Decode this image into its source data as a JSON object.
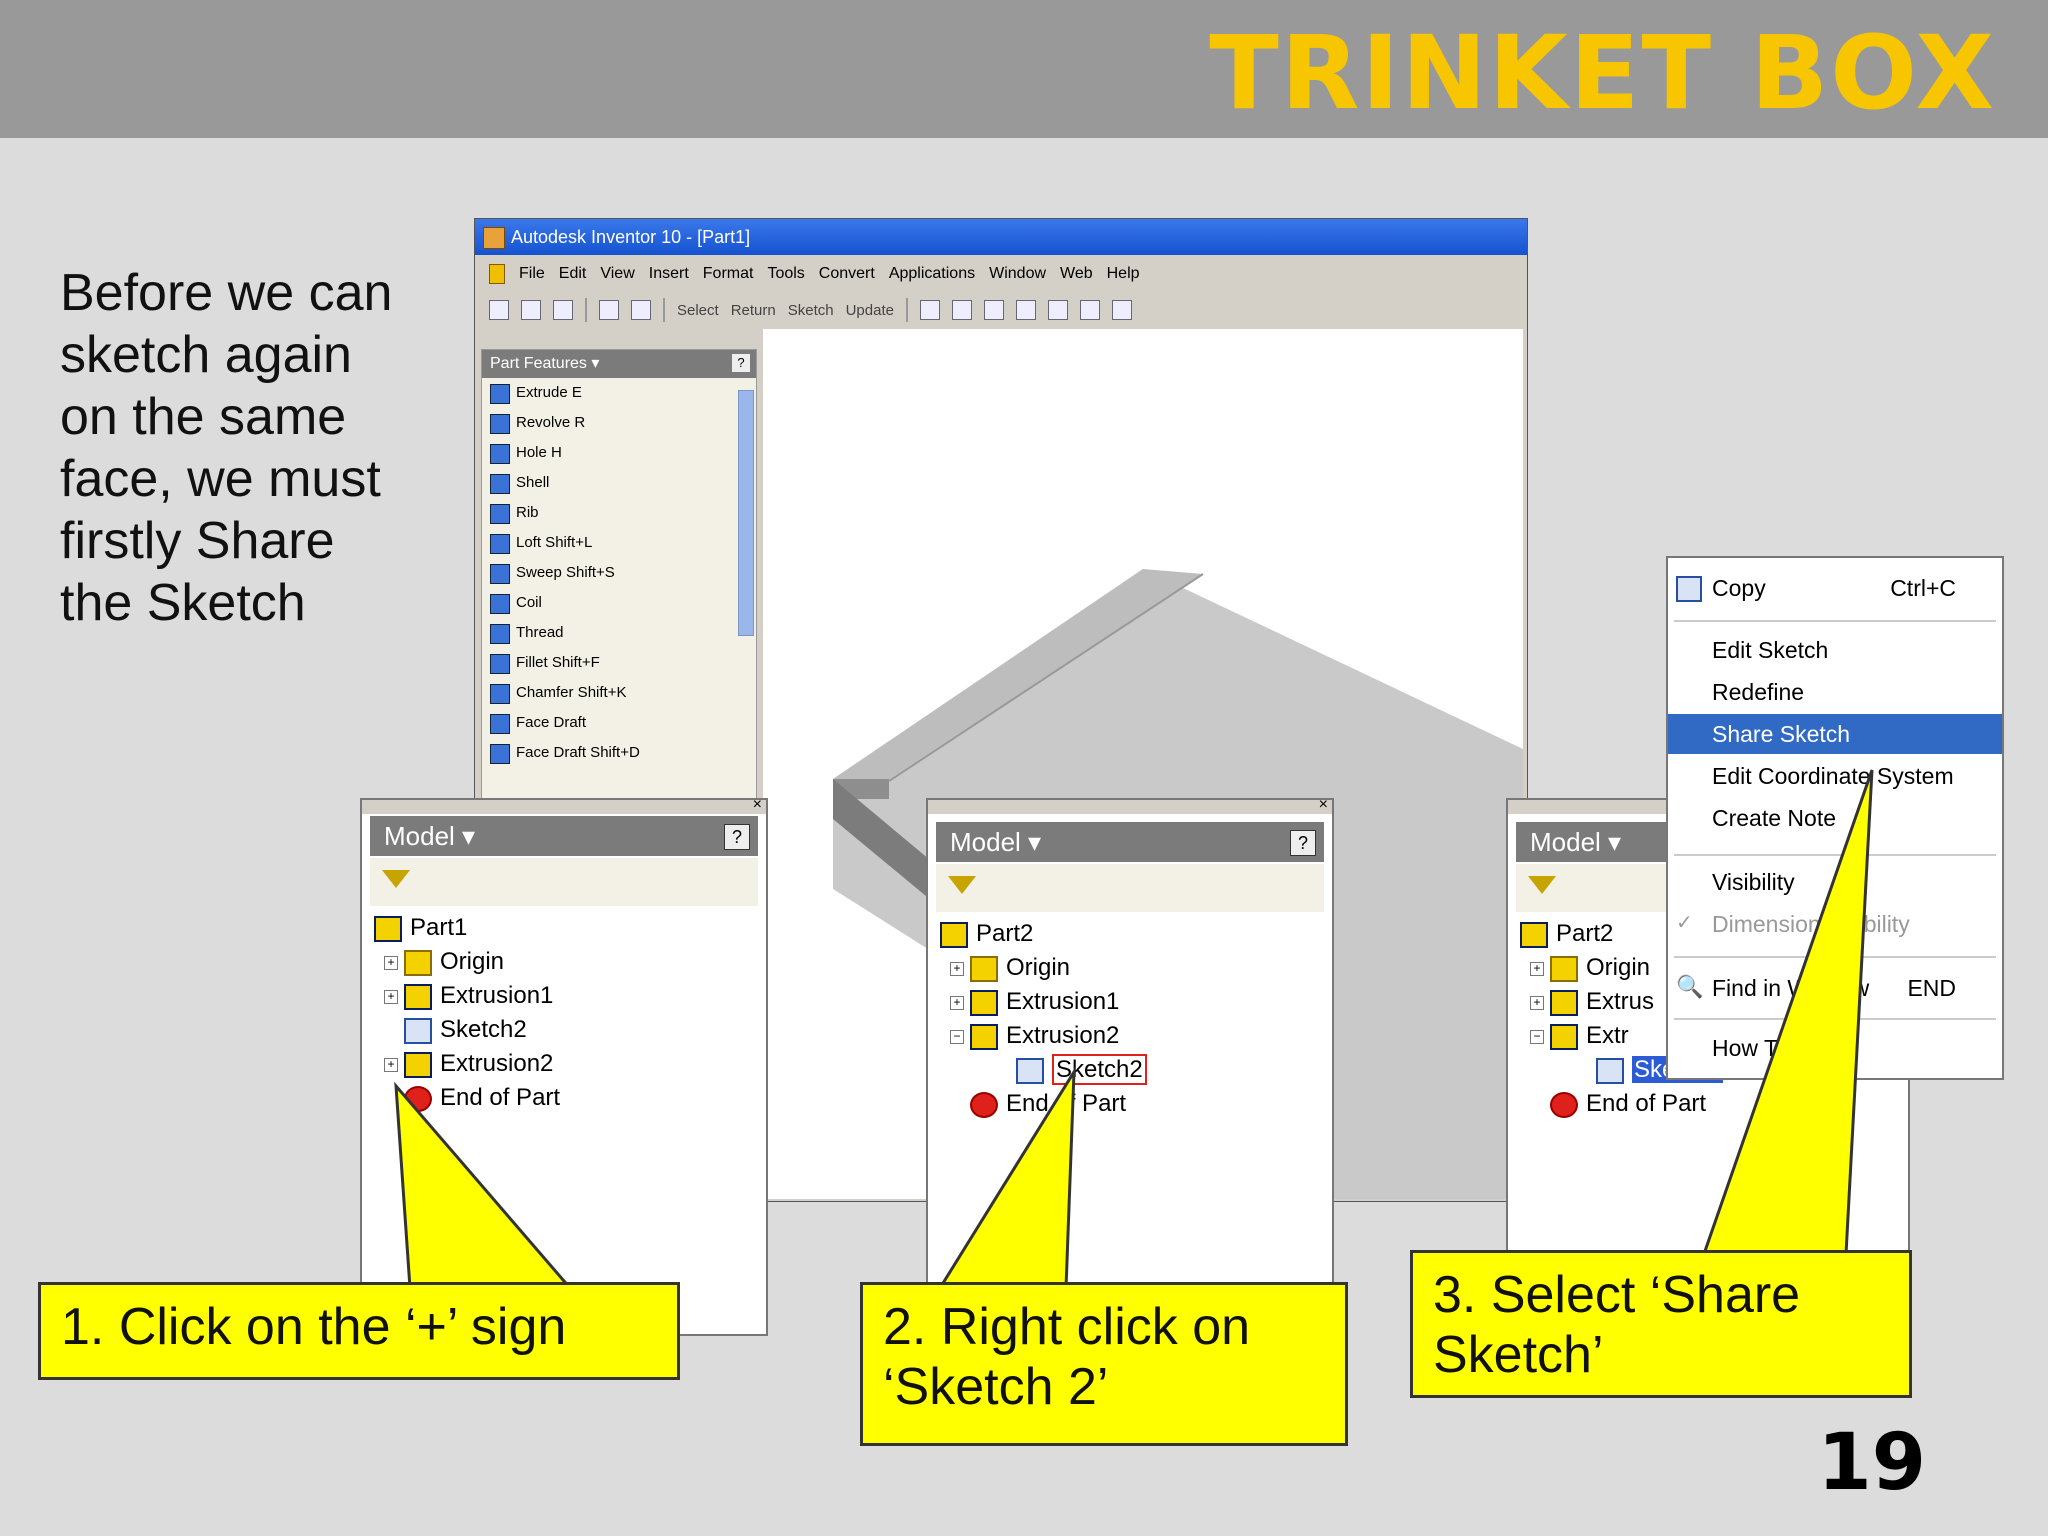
{
  "slide": {
    "title": "TRINKET BOX",
    "intro_lines": [
      "Before we can",
      "sketch again",
      "on the same",
      "face, we must",
      "firstly Share",
      "the Sketch"
    ],
    "page_number": "19"
  },
  "window": {
    "title": "Autodesk Inventor 10 - [Part1]",
    "menu": [
      "File",
      "Edit",
      "View",
      "Insert",
      "Format",
      "Tools",
      "Convert",
      "Applications",
      "Window",
      "Web",
      "Help"
    ],
    "toolbar": [
      "Select",
      "Return",
      "Sketch",
      "Update"
    ],
    "features_title": "Part Features ▾",
    "features": [
      "Extrude  E",
      "Revolve  R",
      "Hole  H",
      "Shell",
      "Rib",
      "Loft  Shift+L",
      "Sweep  Shift+S",
      "Coil",
      "Thread",
      "Fillet  Shift+F",
      "Chamfer  Shift+K",
      "Face Draft",
      "Face Draft  Shift+D"
    ]
  },
  "browser_1": {
    "header": "Model ▾",
    "items": [
      "Part1",
      "Origin",
      "Extrusion1",
      "Sketch2",
      "Extrusion2",
      "End of Part"
    ]
  },
  "browser_2": {
    "header": "Model ▾",
    "items": [
      "Part2",
      "Origin",
      "Extrusion1",
      "Extrusion2",
      "Sketch2",
      "End of Part"
    ]
  },
  "browser_3": {
    "header": "Model ▾",
    "items": [
      "Part2",
      "Origin",
      "Extrus",
      "Extr",
      "Sketch2",
      "End of Part"
    ]
  },
  "context_menu": {
    "copy": "Copy",
    "copy_shortcut": "Ctrl+C",
    "edit_sketch": "Edit Sketch",
    "redefine": "Redefine",
    "share_sketch": "Share Sketch",
    "edit_coord": "Edit Coordinate System",
    "create_note": "Create Note",
    "visibility": "Visibility",
    "dimension_visibility": "Dimension Visibility",
    "find_in_window": "Find in Window",
    "find_shortcut": "END",
    "how_to": "How To..."
  },
  "callouts": {
    "step1": "1. Click on the ‘+’ sign",
    "step2": "2. Right click on ‘Sketch 2’",
    "step3": "3. Select ‘Share Sketch’"
  },
  "colors": {
    "title": "#f7c600",
    "callout": "#ffff00",
    "header_band": "#999999"
  }
}
